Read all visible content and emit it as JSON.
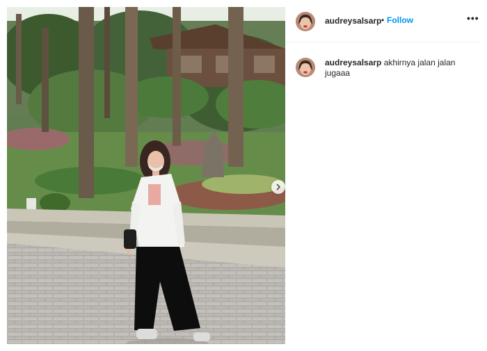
{
  "post": {
    "username": "audreysalsarp",
    "separator": "•",
    "follow_label": "Follow",
    "more_icon": "more-options-icon",
    "caption_username": "audreysalsarp",
    "caption_text": "akhirnya jalan jalan jugaaa",
    "next_icon": "chevron-right-icon"
  }
}
